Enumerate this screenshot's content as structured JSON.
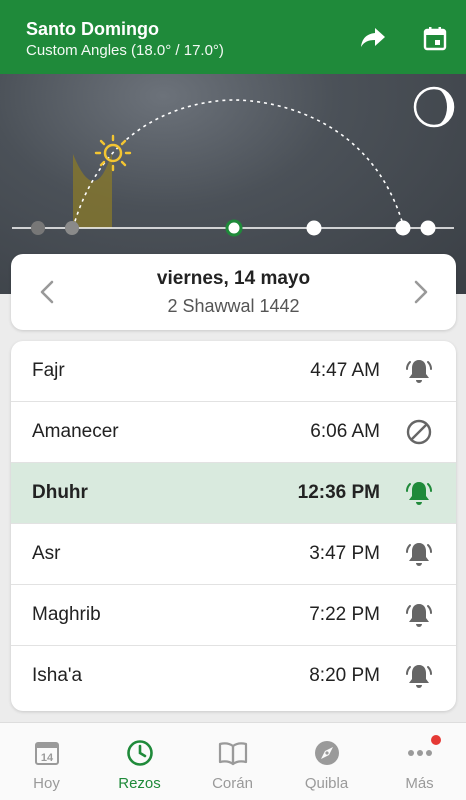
{
  "header": {
    "city": "Santo Domingo",
    "method": "Custom Angles (18.0° / 17.0°)"
  },
  "date": {
    "gregorian": "viernes, 14 mayo",
    "hijri": "2 Shawwal 1442"
  },
  "prayers": [
    {
      "name": "Fajr",
      "time": "4:47 AM",
      "icon": "bell-icon",
      "active": false
    },
    {
      "name": "Amanecer",
      "time": "6:06 AM",
      "icon": "disabled-icon",
      "active": false
    },
    {
      "name": "Dhuhr",
      "time": "12:36 PM",
      "icon": "bell-icon",
      "active": true
    },
    {
      "name": "Asr",
      "time": "3:47 PM",
      "icon": "bell-icon",
      "active": false
    },
    {
      "name": "Maghrib",
      "time": "7:22 PM",
      "icon": "bell-icon",
      "active": false
    },
    {
      "name": "Isha'a",
      "time": "8:20 PM",
      "icon": "bell-icon",
      "active": false
    }
  ],
  "tabs": [
    {
      "label": "Hoy",
      "icon": "calendar-14-icon",
      "active": false
    },
    {
      "label": "Rezos",
      "icon": "clock-icon",
      "active": true
    },
    {
      "label": "Corán",
      "icon": "book-icon",
      "active": false
    },
    {
      "label": "Quibla",
      "icon": "compass-icon",
      "active": false
    },
    {
      "label": "Más",
      "icon": "more-icon",
      "active": false,
      "badge": true
    }
  ],
  "calendar_icon_day": "14",
  "colors": {
    "primary": "#1f8a3a",
    "active_row": "#d9eade",
    "sun": "#f3c532",
    "badge": "#e53935"
  }
}
